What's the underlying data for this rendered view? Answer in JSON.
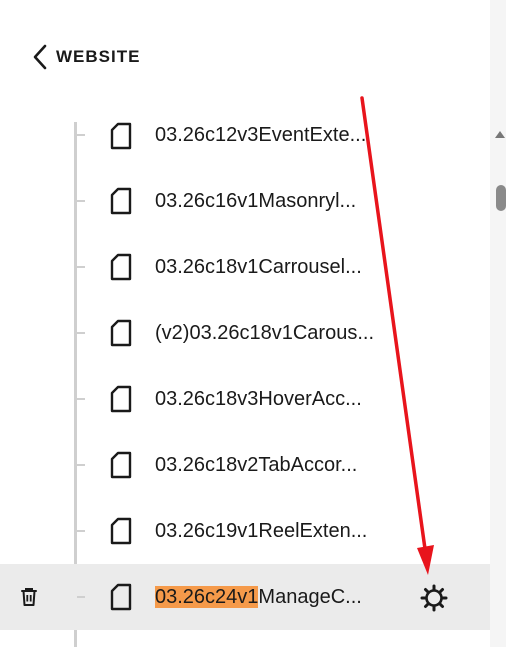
{
  "header": {
    "back_label": "WEBSITE"
  },
  "pages": [
    {
      "label": "03.26c12v3EventExte..."
    },
    {
      "label": "03.26c16v1Masonryl..."
    },
    {
      "label": "03.26c18v1Carrousel..."
    },
    {
      "label": "(v2)03.26c18v1Carous..."
    },
    {
      "label": "03.26c18v3HoverAcc..."
    },
    {
      "label": "03.26c18v2TabAccor..."
    },
    {
      "label": "03.26c19v1ReelExten..."
    }
  ],
  "selected_page": {
    "label_highlight": "03.26c24v1",
    "label_rest": "ManageC..."
  },
  "icons": {
    "back": "chevron-left-icon",
    "page": "page-icon",
    "trash": "trash-icon",
    "gear": "gear-icon",
    "scroll_up": "scroll-up-arrow-icon"
  },
  "colors": {
    "highlight": "#f59a4a",
    "selected_row": "#ebebeb",
    "annotation_arrow": "#e8141c"
  }
}
